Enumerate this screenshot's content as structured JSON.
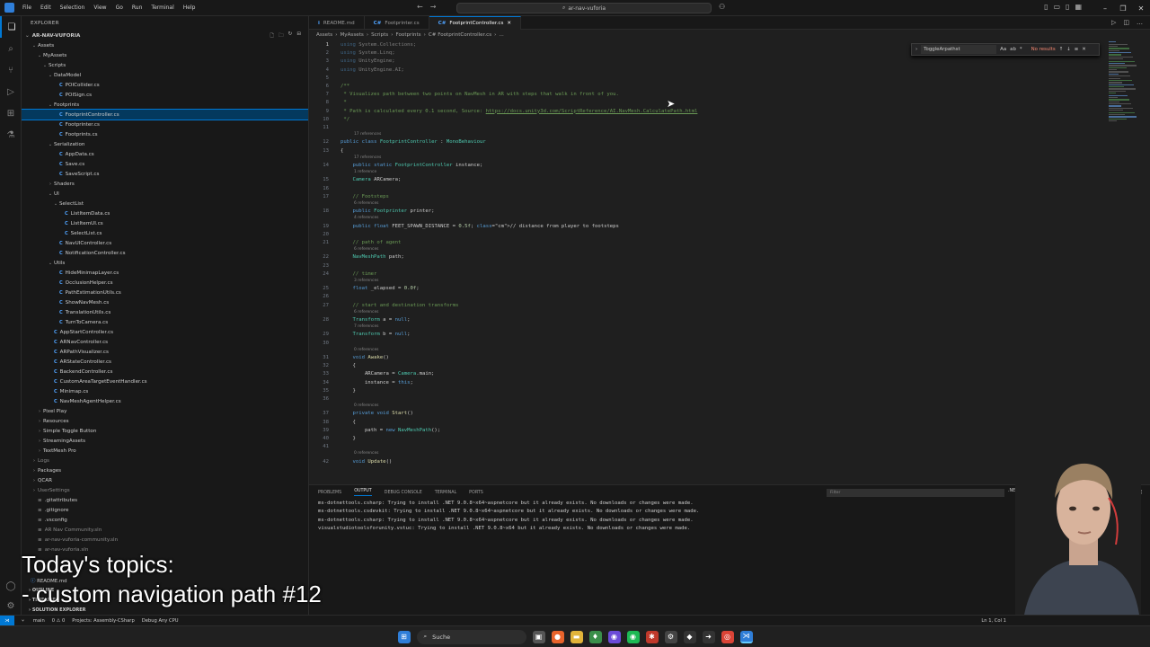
{
  "menu": [
    "File",
    "Edit",
    "Selection",
    "View",
    "Go",
    "Run",
    "Terminal",
    "Help"
  ],
  "command_center": "ar-nav-vuforia",
  "explorer_title": "EXPLORER",
  "root_folder": "AR-NAV-VUFORIA",
  "tree": [
    {
      "label": "Assets",
      "depth": 1,
      "type": "folder"
    },
    {
      "label": "MyAssets",
      "depth": 2,
      "type": "folder"
    },
    {
      "label": "Scripts",
      "depth": 3,
      "type": "folder"
    },
    {
      "label": "DataModel",
      "depth": 4,
      "type": "folder"
    },
    {
      "label": "POICollider.cs",
      "depth": 5,
      "type": "cs"
    },
    {
      "label": "POISign.cs",
      "depth": 5,
      "type": "cs"
    },
    {
      "label": "Footprints",
      "depth": 4,
      "type": "folder"
    },
    {
      "label": "FootprintController.cs",
      "depth": 5,
      "type": "cs",
      "selected": true
    },
    {
      "label": "Footprinter.cs",
      "depth": 5,
      "type": "cs"
    },
    {
      "label": "Footprints.cs",
      "depth": 5,
      "type": "cs"
    },
    {
      "label": "Serialization",
      "depth": 4,
      "type": "folder"
    },
    {
      "label": "AppData.cs",
      "depth": 5,
      "type": "cs"
    },
    {
      "label": "Save.cs",
      "depth": 5,
      "type": "cs"
    },
    {
      "label": "SaveScript.cs",
      "depth": 5,
      "type": "cs"
    },
    {
      "label": "Shaders",
      "depth": 4,
      "type": "folder-closed"
    },
    {
      "label": "UI",
      "depth": 4,
      "type": "folder"
    },
    {
      "label": "SelectList",
      "depth": 5,
      "type": "folder"
    },
    {
      "label": "ListItemData.cs",
      "depth": 6,
      "type": "cs"
    },
    {
      "label": "ListItemUI.cs",
      "depth": 6,
      "type": "cs"
    },
    {
      "label": "SelectList.cs",
      "depth": 6,
      "type": "cs"
    },
    {
      "label": "NavUIController.cs",
      "depth": 5,
      "type": "cs"
    },
    {
      "label": "NotificationController.cs",
      "depth": 5,
      "type": "cs"
    },
    {
      "label": "Utils",
      "depth": 4,
      "type": "folder"
    },
    {
      "label": "HideMinimapLayer.cs",
      "depth": 5,
      "type": "cs"
    },
    {
      "label": "OcclusionHelper.cs",
      "depth": 5,
      "type": "cs"
    },
    {
      "label": "PathEstimationUtils.cs",
      "depth": 5,
      "type": "cs"
    },
    {
      "label": "ShowNavMesh.cs",
      "depth": 5,
      "type": "cs"
    },
    {
      "label": "TranslationUtils.cs",
      "depth": 5,
      "type": "cs"
    },
    {
      "label": "TurnToCamera.cs",
      "depth": 5,
      "type": "cs"
    },
    {
      "label": "AppStartController.cs",
      "depth": 4,
      "type": "cs"
    },
    {
      "label": "ARNavController.cs",
      "depth": 4,
      "type": "cs"
    },
    {
      "label": "ARPathVisualizer.cs",
      "depth": 4,
      "type": "cs"
    },
    {
      "label": "ARStateController.cs",
      "depth": 4,
      "type": "cs"
    },
    {
      "label": "BackendController.cs",
      "depth": 4,
      "type": "cs"
    },
    {
      "label": "CustomAreaTargetEventHandler.cs",
      "depth": 4,
      "type": "cs"
    },
    {
      "label": "Minimap.cs",
      "depth": 4,
      "type": "cs"
    },
    {
      "label": "NavMeshAgentHelper.cs",
      "depth": 4,
      "type": "cs"
    },
    {
      "label": "Pixel Play",
      "depth": 2,
      "type": "folder-closed"
    },
    {
      "label": "Resources",
      "depth": 2,
      "type": "folder-closed"
    },
    {
      "label": "Simple Toggle Button",
      "depth": 2,
      "type": "folder-closed"
    },
    {
      "label": "StreamingAssets",
      "depth": 2,
      "type": "folder-closed"
    },
    {
      "label": "TextMesh Pro",
      "depth": 2,
      "type": "folder-closed"
    },
    {
      "label": "Logs",
      "depth": 1,
      "type": "folder-closed",
      "dim": true
    },
    {
      "label": "Packages",
      "depth": 1,
      "type": "folder-closed"
    },
    {
      "label": "QCAR",
      "depth": 1,
      "type": "folder-closed"
    },
    {
      "label": "UserSettings",
      "depth": 1,
      "type": "folder-closed",
      "dim": true
    },
    {
      "label": ".gitattributes",
      "depth": 1,
      "type": "file"
    },
    {
      "label": ".gitignore",
      "depth": 1,
      "type": "file"
    },
    {
      "label": ".vsconfig",
      "depth": 1,
      "type": "file"
    },
    {
      "label": "AR Nav Community.sln",
      "depth": 1,
      "type": "file",
      "dim": true
    },
    {
      "label": "ar-nav-vuforia-community.sln",
      "depth": 1,
      "type": "file",
      "dim": true
    },
    {
      "label": "ar-nav-vuforia.sln",
      "depth": 1,
      "type": "file",
      "dim": true
    }
  ],
  "sidebar_bottom": {
    "readme": "README.md",
    "outline": "OUTLINE",
    "timeline": "TIMELINE",
    "solution": "SOLUTION EXPLORER"
  },
  "tabs": [
    {
      "label": "README.md",
      "active": false,
      "icon": "i"
    },
    {
      "label": "Footprinter.cs",
      "active": false,
      "icon": "C#"
    },
    {
      "label": "FootprintController.cs",
      "active": true,
      "icon": "C#"
    }
  ],
  "breadcrumb": [
    "Assets",
    "MyAssets",
    "Scripts",
    "Footprints",
    "C# FootprintController.cs",
    "..."
  ],
  "find": {
    "value": "ToggleArpathst",
    "results": "No results",
    "options": [
      "Aa",
      "ab",
      "*"
    ]
  },
  "code": [
    {
      "n": "1",
      "t": "using System.Collections;"
    },
    {
      "n": "2",
      "t": "using System.Linq;"
    },
    {
      "n": "3",
      "t": "using UnityEngine;"
    },
    {
      "n": "4",
      "t": "using UnityEngine.AI;"
    },
    {
      "n": "5",
      "t": ""
    },
    {
      "n": "6",
      "t": "/**"
    },
    {
      "n": "7",
      "t": " * Visualizes path between two points on NavMesh in AR with steps that walk in front of you."
    },
    {
      "n": "8",
      "t": " *"
    },
    {
      "n": "9",
      "t": " * Path is calculated every 0.1 second, Source: https://docs.unity3d.com/ScriptReference/AI.NavMesh.CalculatePath.html"
    },
    {
      "n": "10",
      "t": " */"
    },
    {
      "n": "11",
      "t": ""
    },
    {
      "n": "12",
      "t": "public class FootprintController : MonoBehaviour"
    },
    {
      "n": "13",
      "t": "{"
    },
    {
      "n": "14",
      "t": "    public static FootprintController instance;"
    },
    {
      "n": "15",
      "t": "    Camera ARCamera;"
    },
    {
      "n": "16",
      "t": ""
    },
    {
      "n": "17",
      "t": "    // Footsteps"
    },
    {
      "n": "18",
      "t": "    public Footprinter printer;"
    },
    {
      "n": "19",
      "t": "    public float FEET_SPAWN_DISTANCE = 0.5f; // distance from player to footsteps"
    },
    {
      "n": "20",
      "t": ""
    },
    {
      "n": "21",
      "t": "    // path of agent"
    },
    {
      "n": "22",
      "t": "    NavMeshPath path;"
    },
    {
      "n": "23",
      "t": ""
    },
    {
      "n": "24",
      "t": "    // timer"
    },
    {
      "n": "25",
      "t": "    float _elapsed = 0.0f;"
    },
    {
      "n": "26",
      "t": ""
    },
    {
      "n": "27",
      "t": "    // start and destination transforms"
    },
    {
      "n": "28",
      "t": "    Transform a = null;"
    },
    {
      "n": "29",
      "t": "    Transform b = null;"
    },
    {
      "n": "30",
      "t": ""
    },
    {
      "n": "31",
      "t": "    void Awake()"
    },
    {
      "n": "32",
      "t": "    {"
    },
    {
      "n": "33",
      "t": "        ARCamera = Camera.main;"
    },
    {
      "n": "34",
      "t": "        instance = this;"
    },
    {
      "n": "35",
      "t": "    }"
    },
    {
      "n": "36",
      "t": ""
    },
    {
      "n": "37",
      "t": "    private void Start()"
    },
    {
      "n": "38",
      "t": "    {"
    },
    {
      "n": "39",
      "t": "        path = new NavMeshPath();"
    },
    {
      "n": "40",
      "t": "    }"
    },
    {
      "n": "41",
      "t": ""
    },
    {
      "n": "42",
      "t": "    void Update()"
    }
  ],
  "references": [
    {
      "after": "11",
      "t": "17 references"
    },
    {
      "after": "13",
      "t": "17 references"
    },
    {
      "after": "14",
      "t": "1 reference"
    },
    {
      "after": "17",
      "t": "6 references"
    },
    {
      "after": "18",
      "t": "4 references"
    },
    {
      "after": "21",
      "t": "6 references"
    },
    {
      "after": "24",
      "t": "3 references"
    },
    {
      "after": "27",
      "t": "6 references"
    },
    {
      "after": "28",
      "t": "7 references"
    },
    {
      "after": "30",
      "t": "0 references"
    },
    {
      "after": "36",
      "t": "0 references"
    },
    {
      "after": "41",
      "t": "0 references"
    }
  ],
  "panel": {
    "tabs": [
      "PROBLEMS",
      "OUTPUT",
      "DEBUG CONSOLE",
      "TERMINAL",
      "PORTS"
    ],
    "active_tab": "OUTPUT",
    "filter_placeholder": "Filter",
    "channel": ".NET In",
    "lines": [
      "ms-dotnettools.csharp: Trying to install .NET 9.0.8~x64~aspnetcore but it already exists. No downloads or changes were made.",
      "ms-dotnettools.csdevkit: Trying to install .NET 9.0.8~x64~aspnetcore but it already exists. No downloads or changes were made.",
      "ms-dotnettools.csharp: Trying to install .NET 9.0.8~x64~aspnetcore but it already exists. No downloads or changes were made.",
      "visualstudiotoolsforunity.vstuc: Trying to install .NET 9.0.8~x64 but it already exists. No downloads or changes were made."
    ]
  },
  "status": {
    "branch": "main",
    "problems": "0 ⚠ 0",
    "projects": "Projects: Assembly-CSharp",
    "debug": "Debug Any CPU",
    "position": "Ln 1, Col 1"
  },
  "taskbar_search": "Suche",
  "overlay": {
    "line1": "Today's topics:",
    "line2": "- custom navigation path #12"
  }
}
